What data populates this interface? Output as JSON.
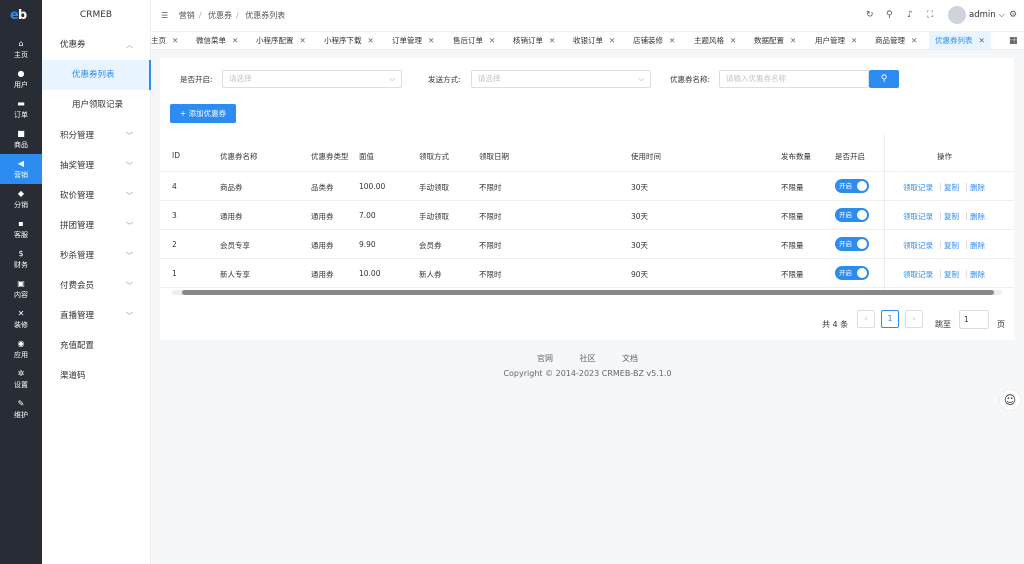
{
  "logo": {
    "e": "e",
    "b": "b"
  },
  "rail": [
    {
      "icon": "⌂",
      "label": "主页"
    },
    {
      "icon": "●",
      "label": "用户"
    },
    {
      "icon": "▬",
      "label": "订单"
    },
    {
      "icon": "■",
      "label": "商品"
    },
    {
      "icon": "◀",
      "label": "营销"
    },
    {
      "icon": "◆",
      "label": "分销"
    },
    {
      "icon": "▪",
      "label": "客服"
    },
    {
      "icon": "$",
      "label": "财务"
    },
    {
      "icon": "▣",
      "label": "内容"
    },
    {
      "icon": "✕",
      "label": "装修"
    },
    {
      "icon": "◉",
      "label": "应用"
    },
    {
      "icon": "✲",
      "label": "设置"
    },
    {
      "icon": "✎",
      "label": "维护"
    }
  ],
  "menu": {
    "brand": "CRMEB",
    "group": "优惠券",
    "sub": [
      "优惠券列表",
      "用户领取记录"
    ],
    "items": [
      "积分管理",
      "抽奖管理",
      "砍价管理",
      "拼团管理",
      "秒杀管理",
      "付费会员",
      "直播管理",
      "充值配置",
      "渠道码"
    ]
  },
  "breadcrumb": [
    "营销",
    "优惠券",
    "优惠券列表"
  ],
  "user": {
    "name": "admin"
  },
  "tabs": [
    "主页",
    "微信菜单",
    "小程序配置",
    "小程序下载",
    "订单管理",
    "售后订单",
    "核销订单",
    "收银订单",
    "店铺装修",
    "主题风格",
    "数据配置",
    "用户管理",
    "商品管理",
    "优惠券列表"
  ],
  "filters": {
    "open_label": "是否开启:",
    "open_placeholder": "请选择",
    "send_label": "发送方式:",
    "send_placeholder": "请选择",
    "name_label": "优惠券名称:",
    "name_placeholder": "请输入优惠券名称"
  },
  "add_button": "+ 添加优惠券",
  "table": {
    "headers": [
      "ID",
      "优惠券名称",
      "优惠券类型",
      "面值",
      "领取方式",
      "领取日期",
      "使用时间",
      "发布数量",
      "是否开启",
      "操作"
    ],
    "rows": [
      {
        "id": "4",
        "name": "商品券",
        "type": "品类券",
        "value": "100.00",
        "method": "手动领取",
        "date": "不限时",
        "use": "30天",
        "count": "不限量",
        "status": "开启"
      },
      {
        "id": "3",
        "name": "通用券",
        "type": "通用券",
        "value": "7.00",
        "method": "手动领取",
        "date": "不限时",
        "use": "30天",
        "count": "不限量",
        "status": "开启"
      },
      {
        "id": "2",
        "name": "会员专享",
        "type": "通用券",
        "value": "9.90",
        "method": "会员券",
        "date": "不限时",
        "use": "30天",
        "count": "不限量",
        "status": "开启"
      },
      {
        "id": "1",
        "name": "新人专享",
        "type": "通用券",
        "value": "10.00",
        "method": "新人券",
        "date": "不限时",
        "use": "90天",
        "count": "不限量",
        "status": "开启"
      }
    ],
    "actions": [
      "领取记录",
      "复制",
      "删除"
    ]
  },
  "pagination": {
    "total": "共 4 条",
    "current": "1",
    "goto": "跳至",
    "value": "1",
    "unit": "页"
  },
  "footer": {
    "links": [
      "官网",
      "社区",
      "文档"
    ],
    "copyright": "Copyright © 2014-2023 CRMEB-BZ v5.1.0"
  },
  "colors": {
    "accent": "#2d8cf0",
    "rail": "#282c35"
  }
}
